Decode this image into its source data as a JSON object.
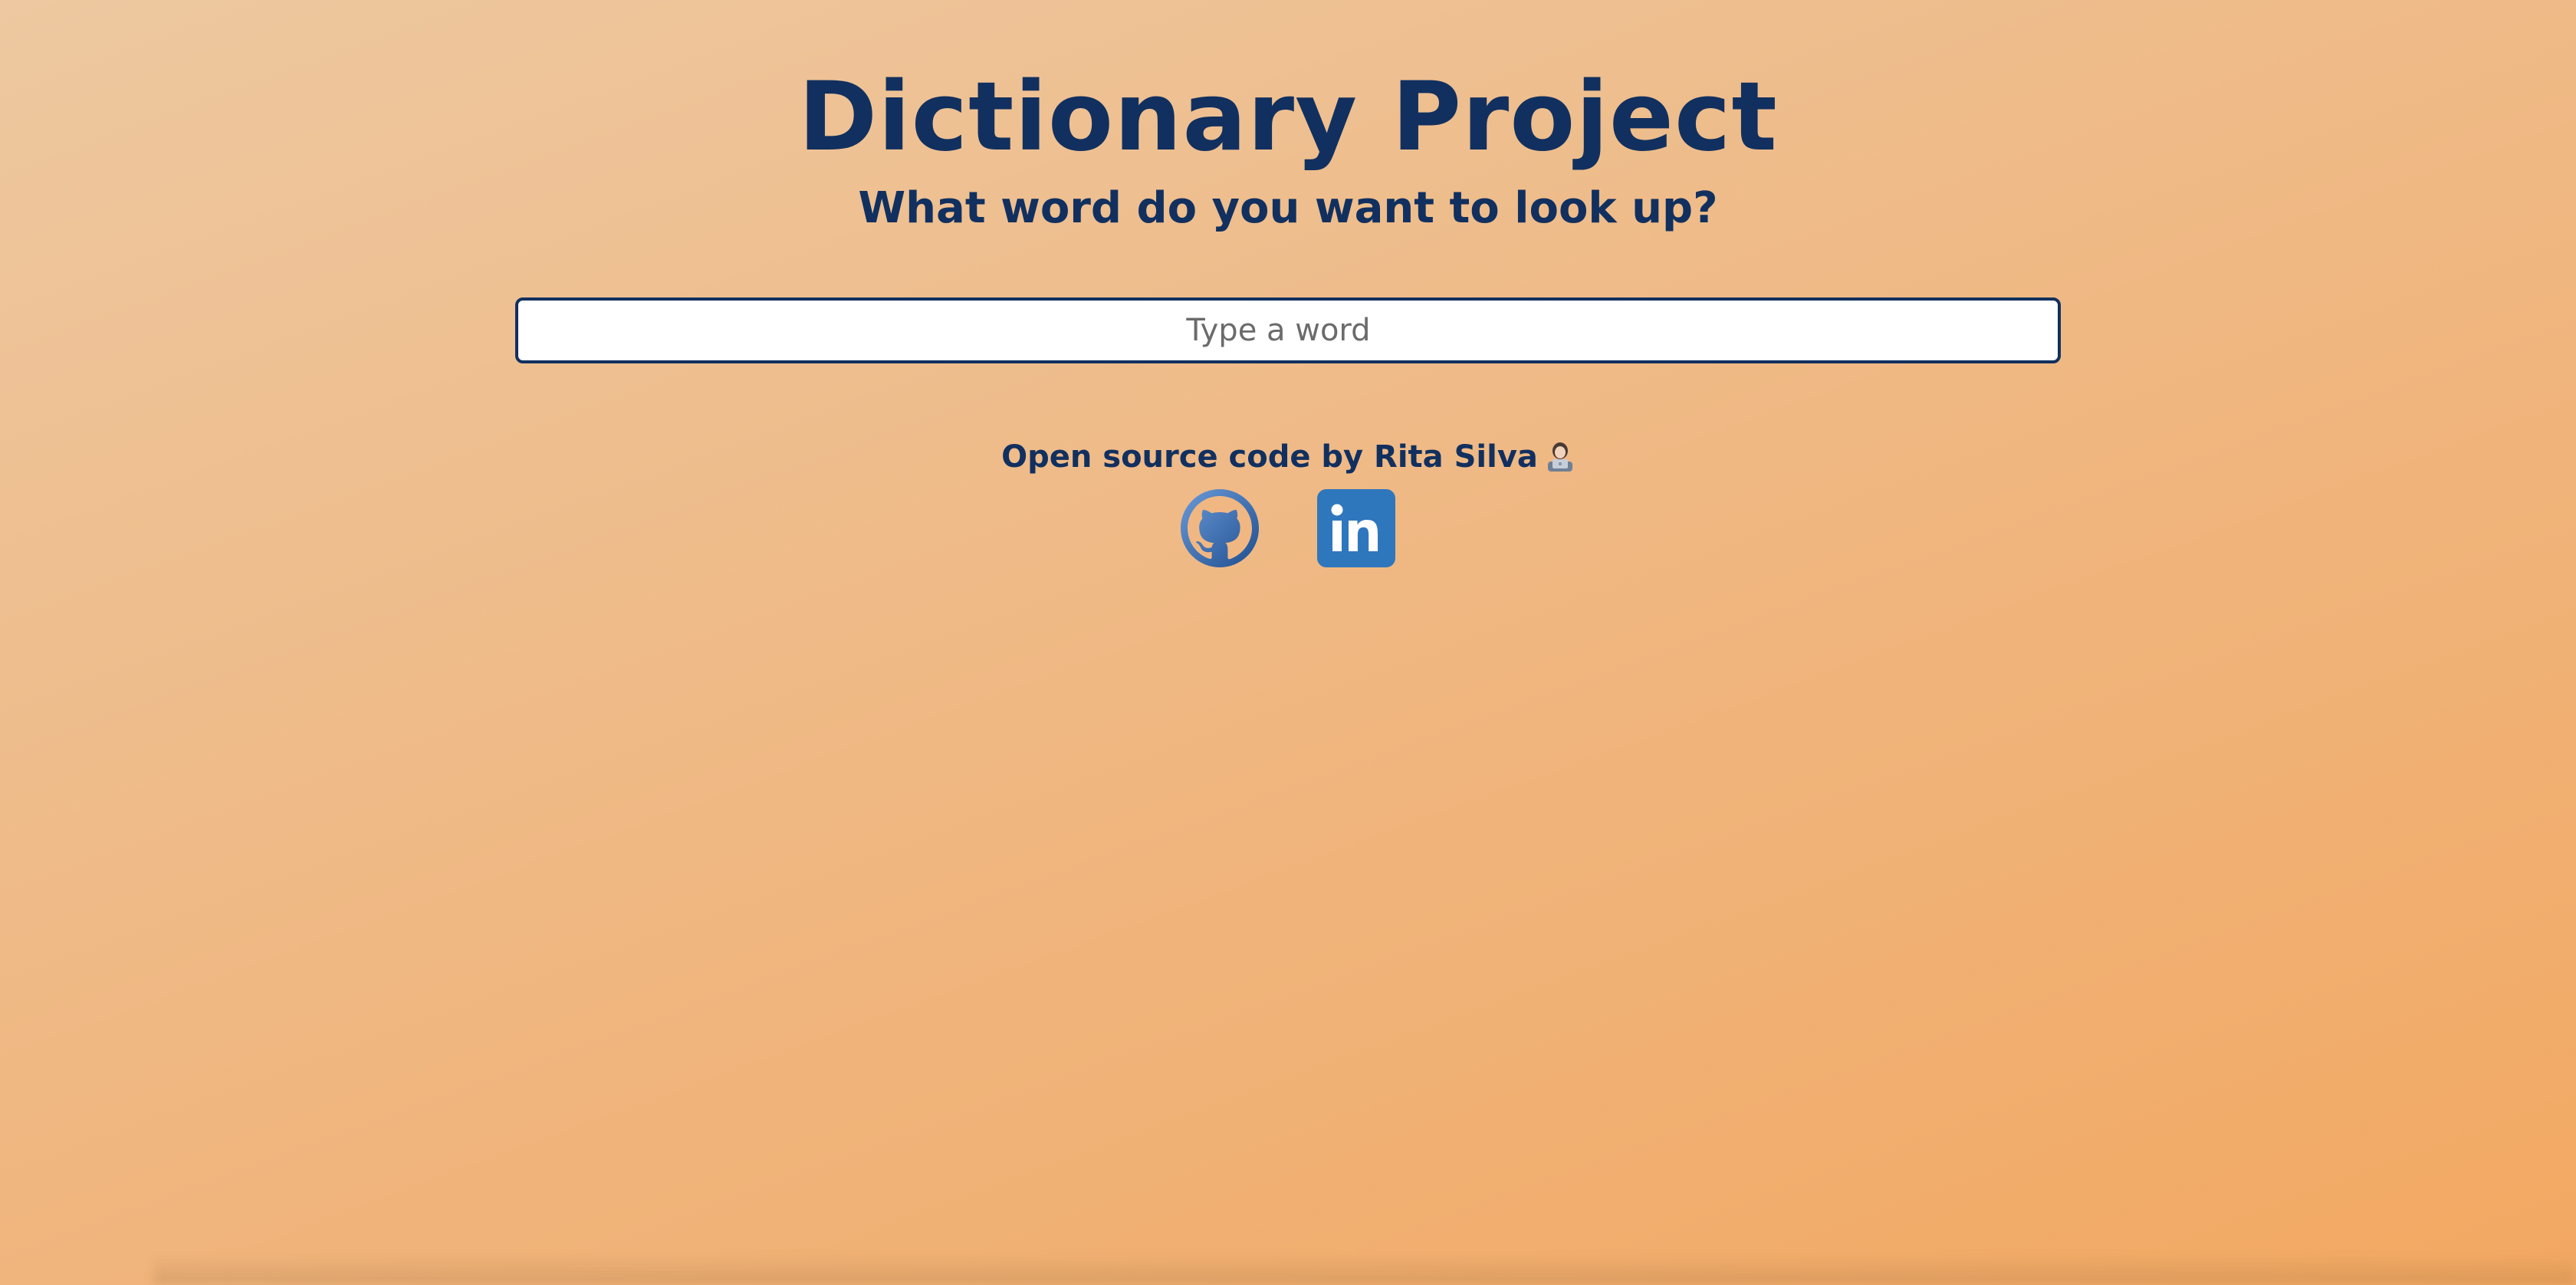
{
  "header": {
    "title": "Dictionary Project",
    "subtitle": "What word do you want to look up?"
  },
  "search": {
    "placeholder": "Type a word",
    "value": ""
  },
  "footer": {
    "credit_text": "Open source code by Rita Silva",
    "credit_emoji_icon": "woman-technologist-icon",
    "links": [
      {
        "name": "github",
        "icon": "github-icon"
      },
      {
        "name": "linkedin",
        "icon": "linkedin-icon"
      }
    ]
  },
  "colors": {
    "primary": "#11305f",
    "background_start": "#edc8a0",
    "background_end": "#f2a862",
    "github_blue": "#3d6fb6",
    "linkedin_blue": "#2f77bd"
  }
}
